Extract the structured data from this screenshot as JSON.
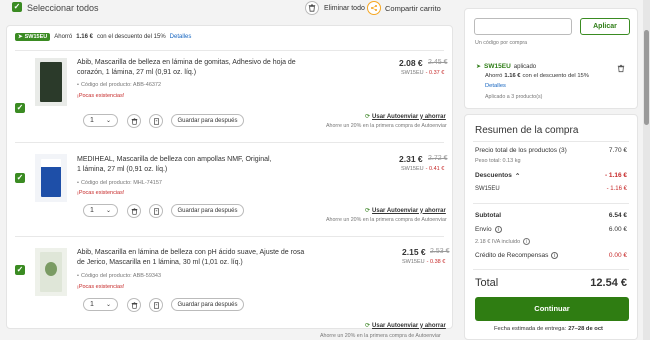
{
  "header": {
    "select_all": "Seleccionar todos",
    "delete_all": "Eliminar todo",
    "share_cart": "Compartir carrito"
  },
  "promo_banner": {
    "code": "SW15EU",
    "text_pre": "Ahorró",
    "amount": "1.16 €",
    "text_post": "con el descuento del 15%",
    "details": "Detalles"
  },
  "items": [
    {
      "title": "Abib, Mascarilla de belleza en lámina de gomitas, Adhesivo de hoja de corazón, 1 lámina, 27 ml (0,91 oz. líq.)",
      "code": "Código del producto: ABB-46372",
      "stock": "¡Pocas existencias!",
      "price": "2.08 €",
      "old_price": "2.45 €",
      "discount": "SW15EU - 0.37 €",
      "qty": "1",
      "save_later": "Guardar para después",
      "autoship": "Usar Autoenviar y ahorrar",
      "autoship_note": "Ahorre un 20% en la primera compra de Autoenviar",
      "thumb_color": "#2b3a2a"
    },
    {
      "title": "MEDIHEAL, Mascarilla de belleza con ampollas NMF, Original, 1 lámina, 27 ml (0,91 oz. líq.)",
      "code": "Código del producto: MHL-74157",
      "stock": "¡Pocas existencias!",
      "price": "2.31 €",
      "old_price": "2.72 €",
      "discount": "SW15EU - 0.41 €",
      "qty": "1",
      "save_later": "Guardar para después",
      "autoship": "Usar Autoenviar y ahorrar",
      "autoship_note": "Ahorre un 20% en la primera compra de Autoenviar",
      "thumb_color": "#1e4fa8"
    },
    {
      "title": "Abib, Mascarilla en lámina de belleza con pH ácido suave, Ajuste de rosa de Jerico, Mascarilla en 1 lámina, 30 ml (1,01 oz. líq.)",
      "code": "Código del producto: ABB-59343",
      "stock": "¡Pocas existencias!",
      "price": "2.15 €",
      "old_price": "2.53 €",
      "discount": "SW15EU - 0.38 €",
      "qty": "1",
      "save_later": "Guardar para después",
      "autoship": "Usar Autoenviar y ahorrar",
      "autoship_note": "Ahorre un 20% en la primera compra de Autoenviar",
      "thumb_color": "#dfe6d8"
    }
  ],
  "coupon": {
    "input_value": "",
    "apply": "Aplicar",
    "hint": "Un código por compra",
    "applied_code": "SW15EU",
    "applied_label": "aplicado",
    "saved_pre": "Ahorró",
    "saved_amount": "1.16 €",
    "saved_post": "con el descuento del 15%",
    "details": "Detalles",
    "applied_to": "Aplicado a 3 producto(s)"
  },
  "summary": {
    "title": "Resumen de la compra",
    "total_products_label": "Precio total de los productos (3)",
    "total_products_value": "7.70 €",
    "weight": "Peso total: 0.13 kg",
    "discounts_label": "Descuentos",
    "discounts_value": "- 1.16 €",
    "discount_code": "SW15EU",
    "discount_code_value": "- 1.16 €",
    "subtotal_label": "Subtotal",
    "subtotal_value": "6.54 €",
    "shipping_label": "Envío",
    "shipping_value": "6.00 €",
    "vat": "2.18 € IVA incluido",
    "credit_label": "Crédito de Recompensas",
    "credit_value": "0.00 €",
    "total_label": "Total",
    "total_value": "12.54 €",
    "continue": "Continuar",
    "delivery_label": "Fecha estimada de entrega:",
    "delivery_value": "27–28 de oct"
  },
  "colors": {
    "accent_green": "#3a8b22",
    "button_green": "#2f7d12",
    "discount_red": "#c62828",
    "link_blue": "#1565c0"
  }
}
